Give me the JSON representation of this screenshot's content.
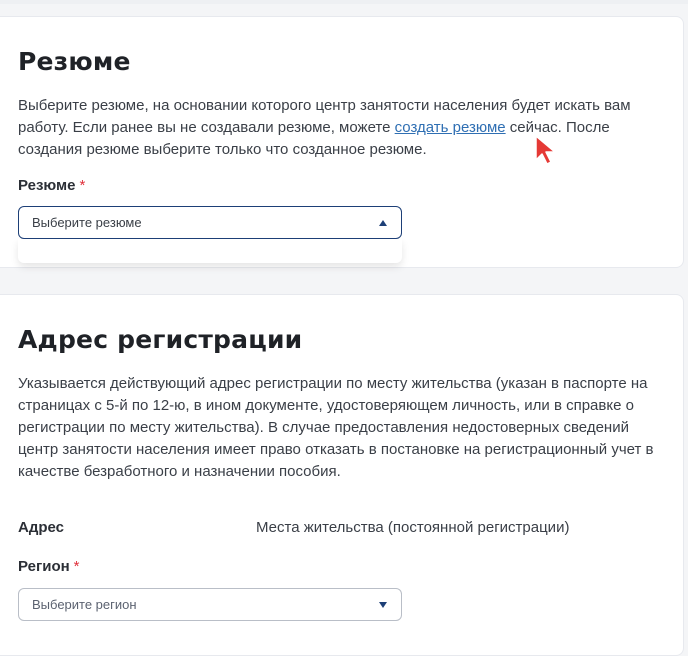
{
  "resume_section": {
    "title": "Резюме",
    "desc_before_link": "Выберите резюме, на основании которого центр занятости населения будет искать вам работу. Если ранее вы не создавали резюме, можете ",
    "link_text": "создать резюме",
    "desc_after_link": " сейчас. После создания резюме выберите только что созданное резюме.",
    "field_label": "Резюме",
    "required_mark": "*",
    "select_placeholder": "Выберите резюме"
  },
  "address_section": {
    "title": "Адрес регистрации",
    "description": "Указывается действующий адрес регистрации по месту жительства (указан в паспорте на страницах с 5-й по 12-ю, в ином документе, удостоверяющем личность, или в справке о регистрации по месту жительства). В случае предоставления недостоверных сведений центр занятости населения имеет право отказать в постановке на регистрационный учет в качестве безработного и назначении пособия.",
    "address_key": "Адрес",
    "address_value": "Места жительства (постоянной регистрации)",
    "region_label": "Регион",
    "required_mark": "*",
    "region_placeholder": "Выберите регион"
  },
  "colors": {
    "accent": "#1d3f77",
    "link": "#2f6fb3",
    "required": "#e0303b",
    "cursor": "#e53935"
  },
  "icons": {
    "resume_select_arrow": "chevron-up-icon",
    "region_select_arrow": "chevron-down-icon",
    "pointer": "mouse-cursor-icon"
  }
}
